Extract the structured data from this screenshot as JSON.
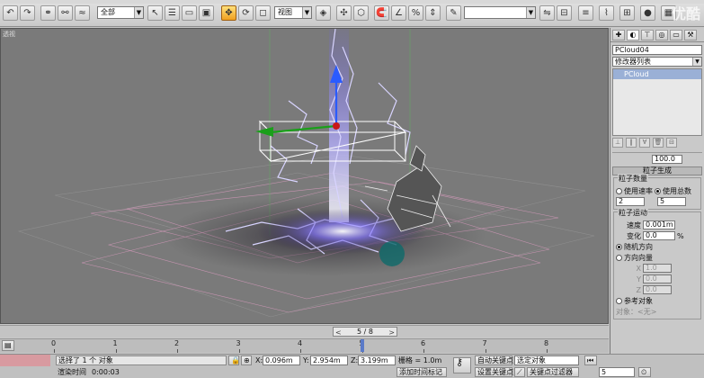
{
  "toolbar": {
    "selection_filter": "全部",
    "reference_coord": "视图",
    "named_selection": ""
  },
  "viewport": {
    "label": "透视"
  },
  "time_slider": {
    "position": "5 / 8",
    "prev": "<",
    "next": ">"
  },
  "track_bar": {
    "ticks": [
      "0",
      "1",
      "2",
      "3",
      "4",
      "5",
      "6",
      "7",
      "8"
    ],
    "current_frame": 5
  },
  "status": {
    "selection": "选择了 1 个 对象",
    "render_time_label": "渲染时间",
    "render_time": "0:00:03",
    "x_label": "X:",
    "x_value": "0.096m",
    "y_label": "Y:",
    "y_value": "2.954m",
    "z_label": "Z:",
    "z_value": "3.199m",
    "grid": "栅格 = 1.0m",
    "add_time_tag": "添加时间标记",
    "auto_key": "自动关键点",
    "set_key": "设置关键点",
    "selected_object": "选定对象",
    "key_filters": "关键点过滤器",
    "frame": "5"
  },
  "panel": {
    "object_name": "PCloud04",
    "modifier_list": "修改器列表",
    "stack_item": "PCloud",
    "spinner_value": "100.0",
    "rollout_title": "粒子生成",
    "particle_quantity": {
      "title": "粒子数量",
      "use_rate": "使用速率",
      "use_total": "使用总数",
      "rate_value": "2",
      "total_value": "5"
    },
    "particle_motion": {
      "title": "粒子运动",
      "speed_label": "速度",
      "speed_value": "0.001m",
      "variation_label": "变化",
      "variation_value": "0.0",
      "variation_unit": "%",
      "random_direction": "随机方向",
      "direction_vector": "方向向量",
      "x_label": "X",
      "x_value": "1.0",
      "y_label": "Y",
      "y_value": "0.0",
      "z_label": "Z",
      "z_value": "0.0",
      "reference_object": "参考对象",
      "object_label": "对象：<无>"
    }
  },
  "watermark": "优酷"
}
